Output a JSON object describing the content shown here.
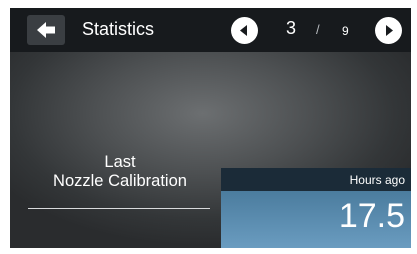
{
  "header": {
    "title": "Statistics",
    "back_icon": "arrow-left-icon",
    "prev_icon": "chevron-left-icon",
    "next_icon": "chevron-right-icon"
  },
  "pagination": {
    "current": "3",
    "separator": "/",
    "total": "9"
  },
  "stat": {
    "label_line1": "Last",
    "label_line2": "Nozzle Calibration",
    "unit": "Hours ago",
    "value": "17.5"
  },
  "colors": {
    "topbar": "#171a1d",
    "value_header": "#1b2b38",
    "value_accent": "#5b8db0"
  }
}
